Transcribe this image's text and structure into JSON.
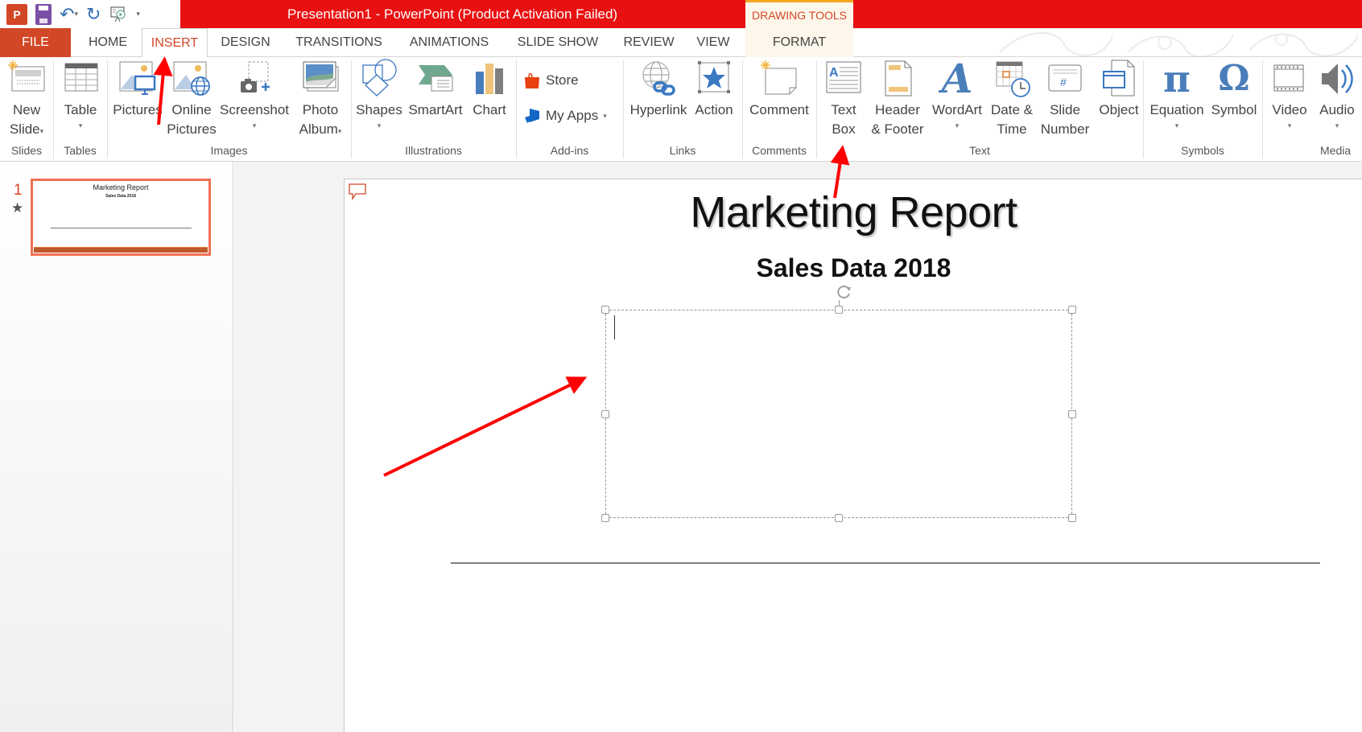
{
  "titlebar": {
    "title": "Presentation1 -  PowerPoint (Product Activation Failed)",
    "context_tab_group": "DRAWING TOOLS",
    "quick_access": [
      "powerpoint-logo",
      "save-icon",
      "undo-icon",
      "redo-icon",
      "start-from-beginning-icon",
      "customize-qat-icon"
    ],
    "logo_text": "P",
    "undo_glyph": "↶",
    "redo_glyph": "↻",
    "caret_glyph": "▾"
  },
  "tabs": [
    {
      "label": "FILE"
    },
    {
      "label": "HOME"
    },
    {
      "label": "INSERT",
      "active": true
    },
    {
      "label": "DESIGN"
    },
    {
      "label": "TRANSITIONS"
    },
    {
      "label": "ANIMATIONS"
    },
    {
      "label": "SLIDE SHOW"
    },
    {
      "label": "REVIEW"
    },
    {
      "label": "VIEW"
    },
    {
      "label": "FORMAT"
    }
  ],
  "ribbon": {
    "groups": {
      "slides": "Slides",
      "tables": "Tables",
      "images": "Images",
      "illustrations": "Illustrations",
      "addins": "Add-ins",
      "links": "Links",
      "comments": "Comments",
      "text": "Text",
      "symbols": "Symbols",
      "media": "Media"
    },
    "buttons": {
      "new_slide": [
        "New",
        "Slide"
      ],
      "table": [
        "Table"
      ],
      "pictures": [
        "Pictures"
      ],
      "online_pictures": [
        "Online",
        "Pictures"
      ],
      "screenshot": [
        "Screenshot"
      ],
      "photo_album": [
        "Photo",
        "Album"
      ],
      "shapes": [
        "Shapes"
      ],
      "smartart": [
        "SmartArt"
      ],
      "chart": [
        "Chart"
      ],
      "store": "Store",
      "my_apps": "My Apps",
      "hyperlink": [
        "Hyperlink"
      ],
      "action": [
        "Action"
      ],
      "comment": [
        "Comment"
      ],
      "text_box": [
        "Text",
        "Box"
      ],
      "header_footer": [
        "Header",
        "& Footer"
      ],
      "wordart": [
        "WordArt"
      ],
      "date_time": [
        "Date &",
        "Time"
      ],
      "slide_number": [
        "Slide",
        "Number"
      ],
      "object": [
        "Object"
      ],
      "equation": [
        "Equation"
      ],
      "symbol": [
        "Symbol"
      ],
      "video": [
        "Video"
      ],
      "audio": [
        "Audio"
      ]
    },
    "glyphs": {
      "pi": "π",
      "omega": "Ω",
      "wordart_a": "A",
      "hash": "#",
      "caret": "▾"
    }
  },
  "slides_pane": {
    "slides": [
      {
        "number": "1",
        "title": "Marketing Report",
        "subtitle": "Sales Data 2018",
        "has_animation_star": true
      }
    ],
    "star_glyph": "★"
  },
  "slide": {
    "title": "Marketing Report",
    "subtitle": "Sales Data 2018",
    "textbox_value": "",
    "textbox_selected": true
  },
  "colors": {
    "title_bar": "#E81010",
    "accent": "#D24726",
    "context_tab": "#FDF6EA",
    "icon_blue": "#4A7EBB",
    "annotation_arrow": "#FF0000"
  },
  "annotations": [
    {
      "type": "arrow",
      "points_to": "tab-insert"
    },
    {
      "type": "arrow",
      "points_to": "text-box-button"
    },
    {
      "type": "arrow",
      "points_to": "slide-textbox"
    }
  ]
}
